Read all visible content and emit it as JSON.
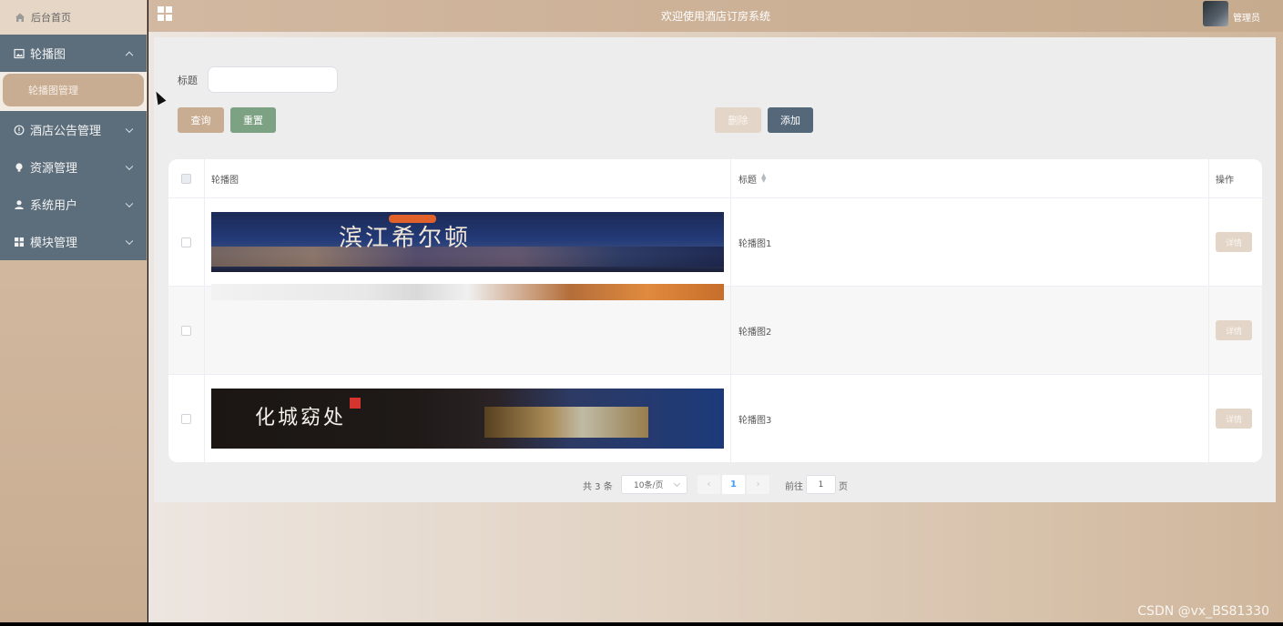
{
  "sidebar": {
    "home_label": "后台首页",
    "menu": [
      {
        "label": "轮播图",
        "icon": "image-icon",
        "expanded": true
      },
      {
        "label": "酒店公告管理",
        "icon": "info-icon",
        "expanded": false
      },
      {
        "label": "资源管理",
        "icon": "bulb-icon",
        "expanded": false
      },
      {
        "label": "系统用户",
        "icon": "user-icon",
        "expanded": false
      },
      {
        "label": "模块管理",
        "icon": "grid-icon",
        "expanded": false
      }
    ],
    "submenu_active": "轮播图管理"
  },
  "header": {
    "title": "欢迎使用酒店订房系统",
    "user": "管理员"
  },
  "search": {
    "label": "标题",
    "value": ""
  },
  "buttons": {
    "query": "查询",
    "reset": "重置",
    "delete": "删除",
    "add": "添加"
  },
  "table": {
    "columns": [
      "轮播图",
      "标题",
      "操作"
    ],
    "rows": [
      {
        "image_label": "滨江希尔顿",
        "title": "轮播图1",
        "action": "详情"
      },
      {
        "image_label": "",
        "title": "轮播图2",
        "action": "详情"
      },
      {
        "image_label": "化城窈处",
        "title": "轮播图3",
        "action": "详情"
      }
    ]
  },
  "pagination": {
    "total": "共 3 条",
    "page_size": "10条/页",
    "current_page": "1",
    "goto_label": "前往",
    "goto_value": "1",
    "goto_suffix": "页"
  },
  "watermark": "CSDN @vx_BS81330",
  "colors": {
    "accent": "#c9ad92",
    "menu_bg": "#5c6e7c",
    "reset": "#7da183",
    "add": "#55687a"
  }
}
